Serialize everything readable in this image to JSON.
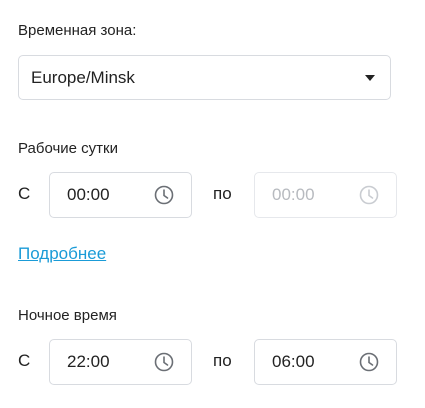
{
  "timezone": {
    "label": "Временная зона:",
    "value": "Europe/Minsk"
  },
  "work_day": {
    "label": "Рабочие сутки",
    "from_prefix": "С",
    "to_prefix": "по",
    "from": "00:00",
    "to": "00:00",
    "to_disabled": true
  },
  "details_link": "Подробнее",
  "night_time": {
    "label": "Ночное время",
    "from_prefix": "С",
    "to_prefix": "по",
    "from": "22:00",
    "to": "06:00"
  },
  "icons": [
    "chevron-down-icon",
    "clock-icon"
  ]
}
